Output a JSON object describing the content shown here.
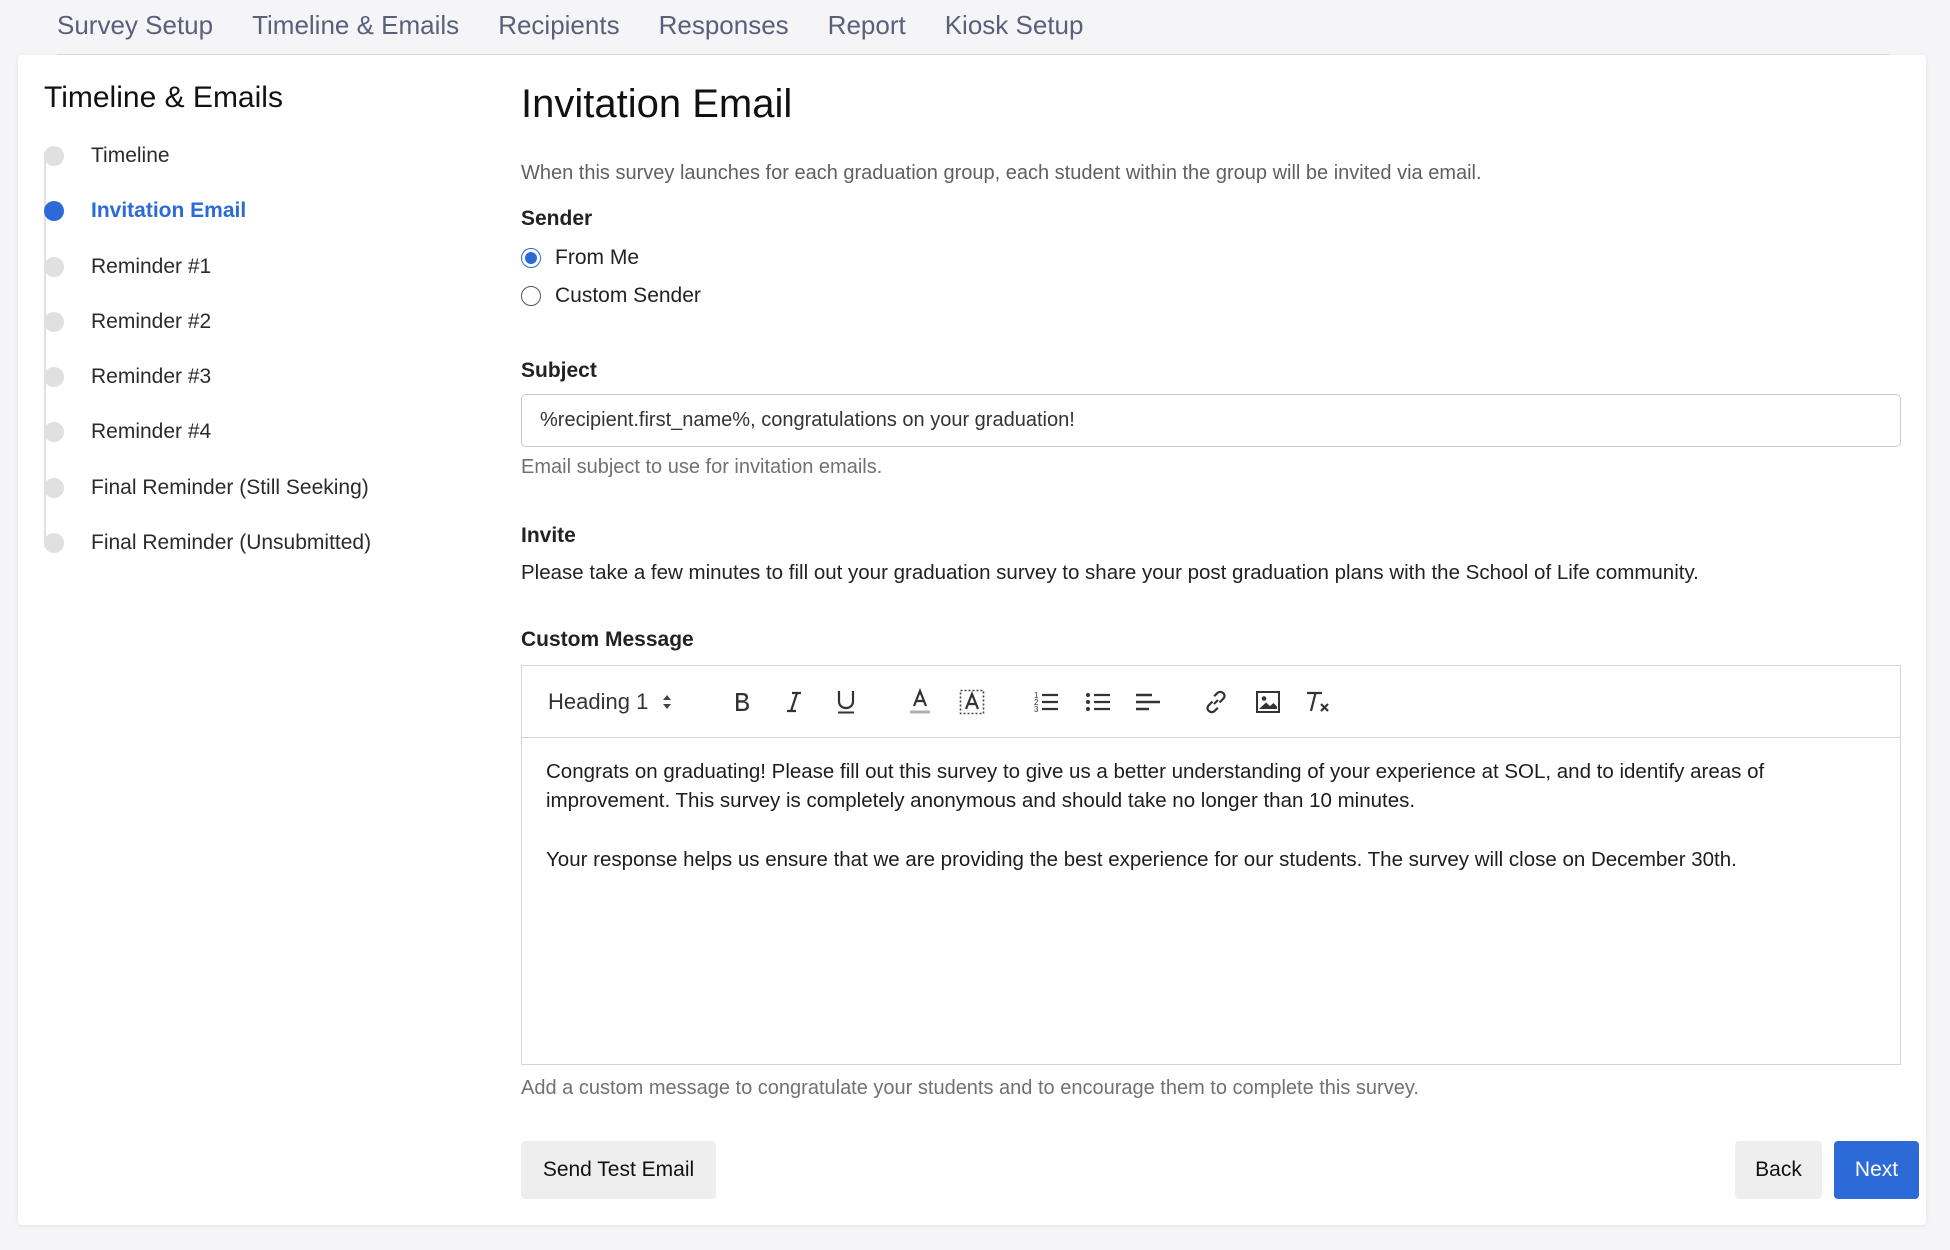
{
  "topnav": {
    "tabs": [
      {
        "label": "Survey Setup"
      },
      {
        "label": "Timeline & Emails"
      },
      {
        "label": "Recipients"
      },
      {
        "label": "Responses"
      },
      {
        "label": "Report"
      },
      {
        "label": "Kiosk Setup"
      }
    ]
  },
  "sidebar": {
    "title": "Timeline & Emails",
    "steps": [
      {
        "label": "Timeline",
        "active": false
      },
      {
        "label": "Invitation Email",
        "active": true
      },
      {
        "label": "Reminder #1",
        "active": false
      },
      {
        "label": "Reminder #2",
        "active": false
      },
      {
        "label": "Reminder #3",
        "active": false
      },
      {
        "label": "Reminder #4",
        "active": false
      },
      {
        "label": "Final Reminder (Still Seeking)",
        "active": false
      },
      {
        "label": "Final Reminder (Unsubmitted)",
        "active": false
      }
    ]
  },
  "main": {
    "title": "Invitation Email",
    "intro": "When this survey launches for each graduation group, each student within the group will be invited via email.",
    "sender": {
      "label": "Sender",
      "options": [
        {
          "label": "From Me",
          "checked": true
        },
        {
          "label": "Custom Sender",
          "checked": false
        }
      ]
    },
    "subject": {
      "label": "Subject",
      "value": "%recipient.first_name%, congratulations on your graduation!",
      "help": "Email subject to use for invitation emails."
    },
    "invite": {
      "label": "Invite",
      "text": "Please take a few minutes to fill out your graduation survey to share your post graduation plans with the School of Life community."
    },
    "custom_message": {
      "label": "Custom Message",
      "heading_select": "Heading 1",
      "toolbar_icons": [
        "bold-icon",
        "italic-icon",
        "underline-icon",
        "text-color-icon",
        "highlight-icon",
        "ordered-list-icon",
        "bullet-list-icon",
        "align-left-icon",
        "link-icon",
        "image-icon",
        "clear-format-icon"
      ],
      "paragraphs": [
        "Congrats on graduating! Please fill out this survey to give us a better understanding of your experience at SOL, and to identify areas of improvement. This survey is completely anonymous and should take no longer than 10 minutes.",
        "Your response helps us ensure that we are providing the best experience for our students. The survey will close on December 30th."
      ],
      "help": "Add a custom message to congratulate your students and to encourage them to complete this survey."
    },
    "buttons": {
      "send_test": "Send Test Email",
      "back": "Back",
      "next": "Next"
    }
  },
  "colors": {
    "accent": "#2c6ad8",
    "nav_text": "#5a5f7a",
    "inactive_dot": "#e0e0e0"
  }
}
